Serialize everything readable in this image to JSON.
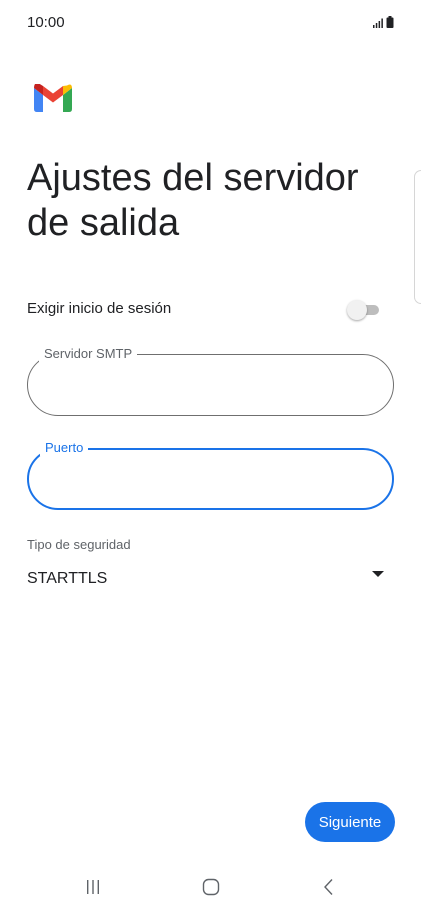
{
  "status_bar": {
    "time": "10:00"
  },
  "app": {
    "logo": "gmail-logo"
  },
  "page": {
    "title": "Ajustes del servidor de salida"
  },
  "login_toggle": {
    "label": "Exigir inicio de sesión",
    "enabled": false
  },
  "smtp_field": {
    "label": "Servidor SMTP",
    "value": ""
  },
  "port_field": {
    "label": "Puerto",
    "value": "",
    "focused": true
  },
  "security": {
    "label": "Tipo de seguridad",
    "selected": "STARTTLS"
  },
  "actions": {
    "next_label": "Siguiente"
  },
  "colors": {
    "accent": "#1a73e8",
    "text": "#202124",
    "secondary_text": "#5f6368",
    "outline": "#6f6f6f"
  },
  "navigation": {
    "icons": [
      "recent-apps-icon",
      "home-icon",
      "back-icon"
    ]
  }
}
